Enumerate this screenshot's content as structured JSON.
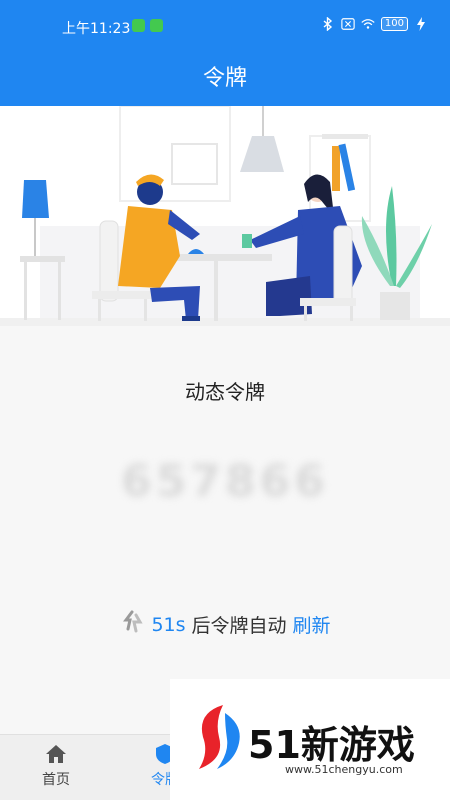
{
  "status_bar": {
    "time": "上午11:23",
    "battery": "100"
  },
  "header": {
    "title": "令牌"
  },
  "token": {
    "label": "动态令牌",
    "code": "657866"
  },
  "refresh": {
    "seconds": "51s",
    "text": "后令牌自动",
    "link": "刷新"
  },
  "nav": {
    "home": "首页",
    "token": "令牌"
  },
  "watermark": {
    "brand": "51新游戏",
    "url": "www.51chengyu.com"
  },
  "colors": {
    "primary": "#1f86f1",
    "background": "#f7f7f7"
  }
}
